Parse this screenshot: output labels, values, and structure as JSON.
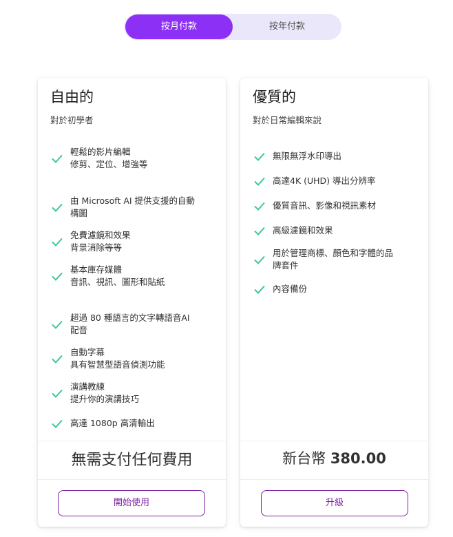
{
  "billing_toggle": {
    "monthly_label": "按月付款",
    "yearly_label": "按年付款",
    "selected": "monthly"
  },
  "plans": [
    {
      "title": "自由的",
      "subtitle": "對於初學者",
      "features": [
        {
          "line1": "輕鬆的影片編輯",
          "line2": "修剪、定位、增強等"
        },
        {
          "line1": "由 Microsoft AI 提供支援的自動",
          "line2": "構圖"
        },
        {
          "line1": "免費濾鏡和效果",
          "line2": "背景消除等等"
        },
        {
          "line1": "基本庫存媒體",
          "line2": "音訊、視訊、圖形和貼紙"
        },
        {
          "line1": "超過 80 種語言的文字轉語音AI",
          "line2": "配音"
        },
        {
          "line1": "自動字幕",
          "line2": "具有智慧型語音偵測功能"
        },
        {
          "line1": "演講教練",
          "line2": "提升你的演講技巧"
        },
        {
          "line1": "高達 1080p 高清輸出",
          "line2": ""
        }
      ],
      "price_text": "無需支付任何費用",
      "cta_label": "開始使用"
    },
    {
      "title": "優質的",
      "subtitle": "對於日常編輯來說",
      "features": [
        {
          "line1": "無限無浮水印導出",
          "line2": ""
        },
        {
          "line1": "高達4K (UHD) 導出分辨率",
          "line2": ""
        },
        {
          "line1": "優質音訊、影像和視訊素材",
          "line2": ""
        },
        {
          "line1": "高級濾鏡和效果",
          "line2": ""
        },
        {
          "line1": "用於管理商標、顏色和字體的品",
          "line2": "牌套件"
        },
        {
          "line1": "內容備份",
          "line2": ""
        }
      ],
      "price_currency": "新台幣",
      "price_amount": "380.00",
      "cta_label": "升級"
    }
  ],
  "colors": {
    "accent_purple": "#8d30f5",
    "button_border": "#7a1fa2",
    "check_green": "#3ec6a0",
    "toggle_bg": "#ebe7fb"
  },
  "icons": {
    "feature_check": "check-icon"
  }
}
